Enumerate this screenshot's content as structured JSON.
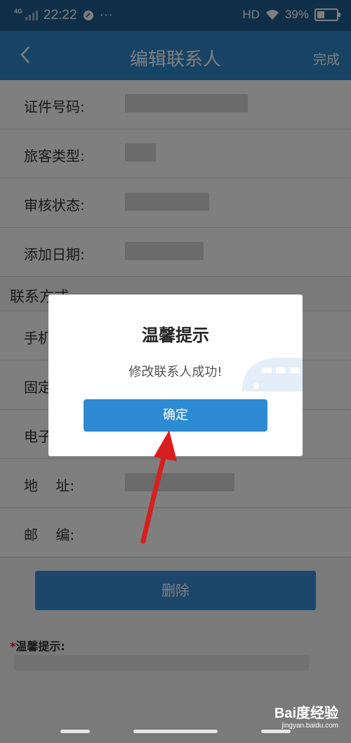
{
  "status_bar": {
    "network": "4G",
    "time": "22:22",
    "more": "···",
    "hd": "HD",
    "battery": "39%"
  },
  "nav": {
    "title": "编辑联系人",
    "done": "完成"
  },
  "form": {
    "rows_top": [
      {
        "label": "证件号码:"
      },
      {
        "label": "旅客类型:"
      },
      {
        "label": "审核状态:"
      },
      {
        "label": "添加日期:"
      }
    ],
    "section_title": "联系方式",
    "rows_contact": [
      {
        "label": "手机:"
      },
      {
        "label": "固定:"
      },
      {
        "label": "电子:"
      },
      {
        "label": "地    址:"
      },
      {
        "label": "邮    编:"
      }
    ]
  },
  "delete_button": "删除",
  "tip": {
    "star": "*",
    "title": "温馨提示:"
  },
  "dialog": {
    "title": "温馨提示",
    "message": "修改联系人成功!",
    "ok_label": "确定"
  },
  "watermark": {
    "brand": "Bai度经验",
    "url": "jingyan.baidu.com"
  }
}
